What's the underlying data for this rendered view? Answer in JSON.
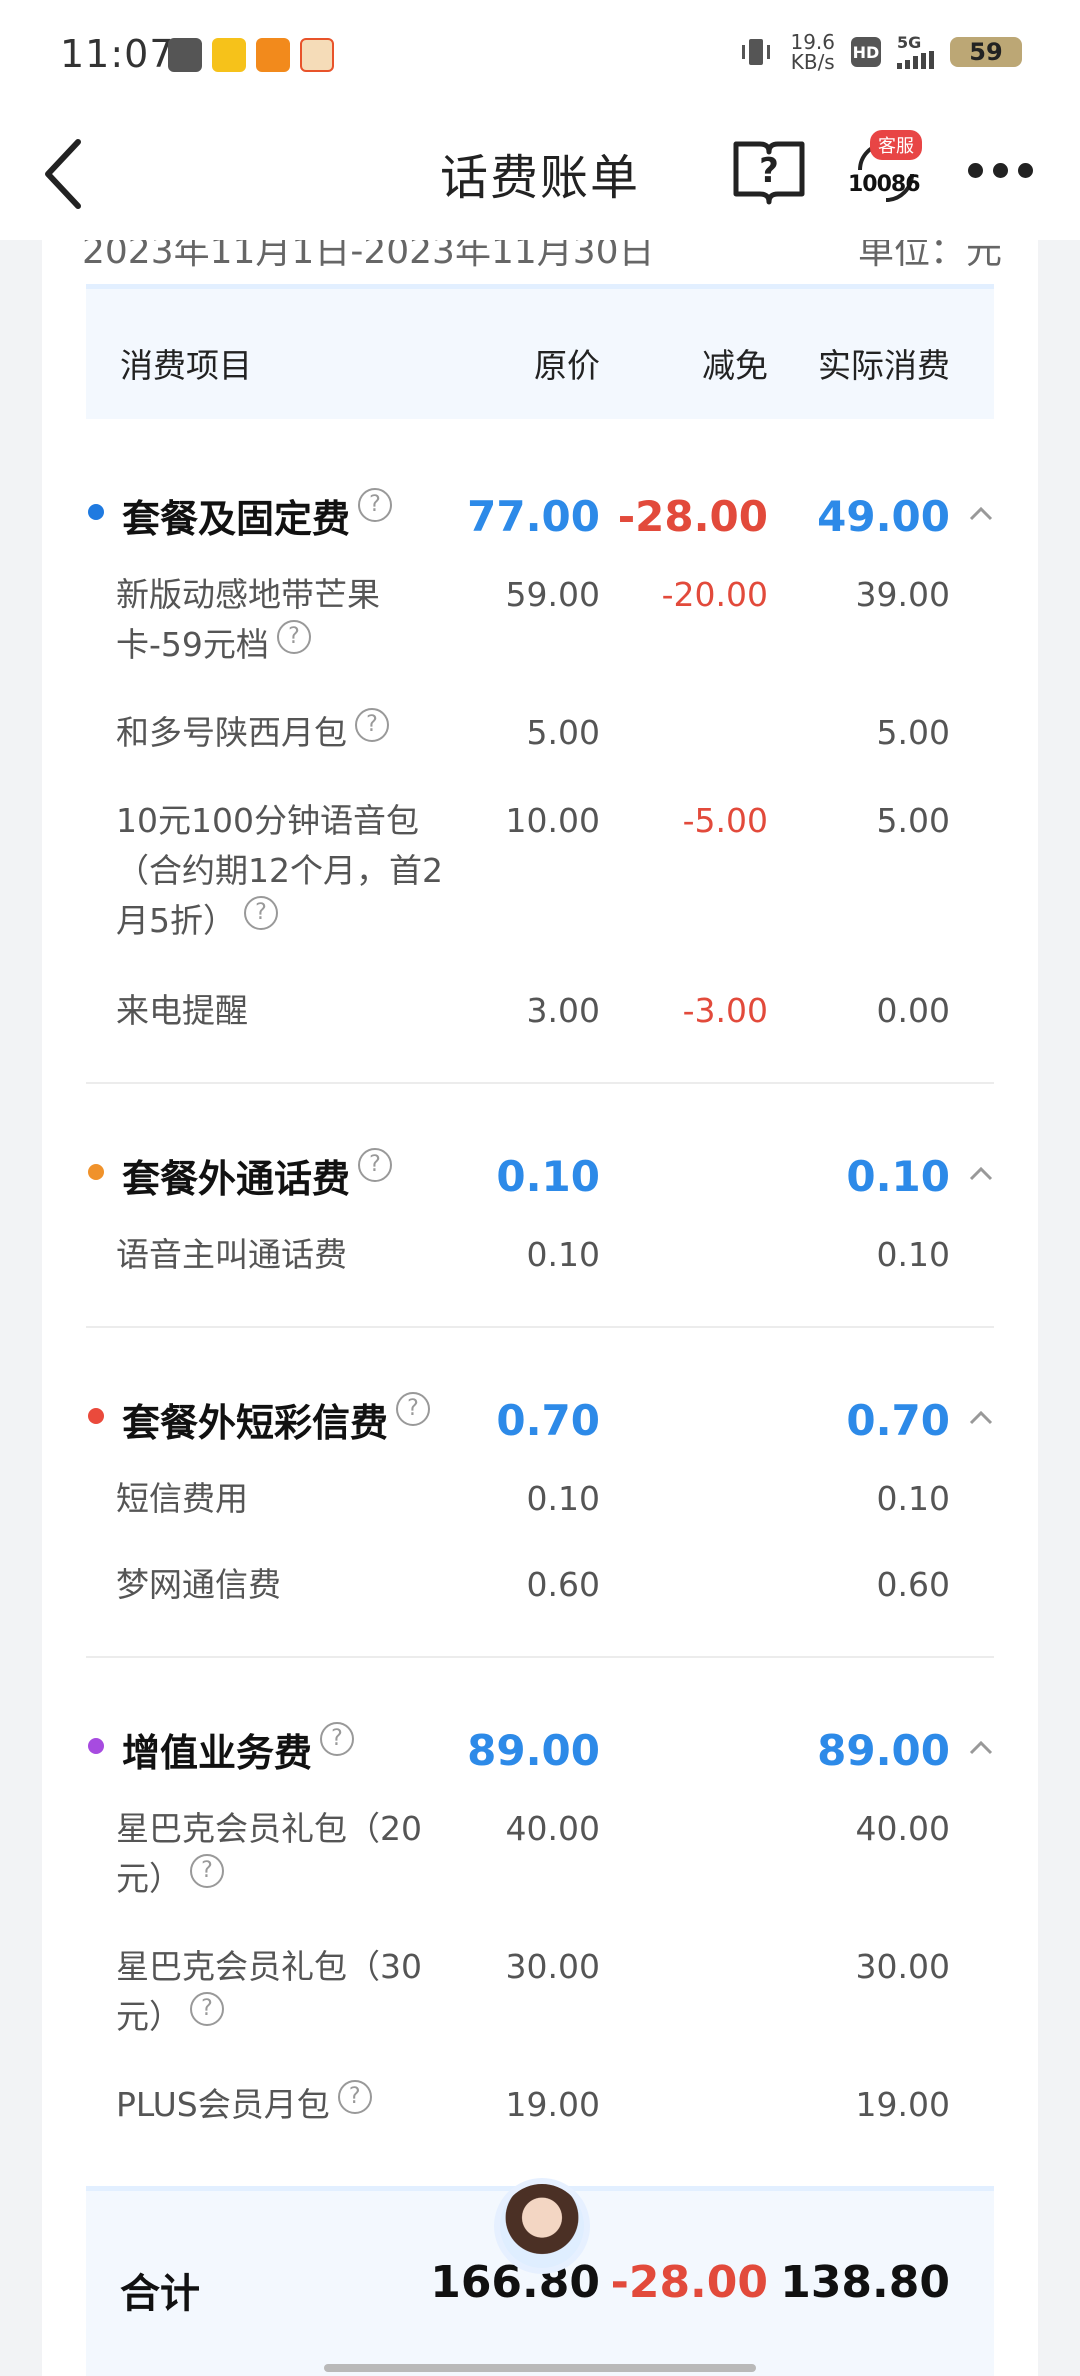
{
  "status_bar": {
    "time": "11:07",
    "net_speed_value": "19.6",
    "net_speed_unit": "KB/s",
    "hd": "HD",
    "network": "5G",
    "battery": "59"
  },
  "header": {
    "title": "话费账单",
    "service_badge": "客服",
    "service_number": "10086"
  },
  "period": {
    "range": "2023年11月1日-2023年11月30日",
    "unit": "单位：元"
  },
  "table_header": {
    "item": "消费项目",
    "original": "原价",
    "discount": "减免",
    "actual": "实际消费"
  },
  "sections": [
    {
      "title": "套餐及固定费",
      "original": "77.00",
      "discount": "-28.00",
      "actual": "49.00",
      "items": [
        {
          "name": "新版动感地带芒果卡-59元档",
          "original": "59.00",
          "discount": "-20.00",
          "actual": "39.00"
        },
        {
          "name": "和多号陕西月包",
          "original": "5.00",
          "discount": "",
          "actual": "5.00"
        },
        {
          "name": "10元100分钟语音包（合约期12个月，首2月5折）",
          "original": "10.00",
          "discount": "-5.00",
          "actual": "5.00"
        },
        {
          "name": "来电提醒",
          "original": "3.00",
          "discount": "-3.00",
          "actual": "0.00"
        }
      ]
    },
    {
      "title": "套餐外通话费",
      "original": "0.10",
      "discount": "",
      "actual": "0.10",
      "items": [
        {
          "name": "语音主叫通话费",
          "original": "0.10",
          "discount": "",
          "actual": "0.10"
        }
      ]
    },
    {
      "title": "套餐外短彩信费",
      "original": "0.70",
      "discount": "",
      "actual": "0.70",
      "items": [
        {
          "name": "短信费用",
          "original": "0.10",
          "discount": "",
          "actual": "0.10"
        },
        {
          "name": "梦网通信费",
          "original": "0.60",
          "discount": "",
          "actual": "0.60"
        }
      ]
    },
    {
      "title": "增值业务费",
      "original": "89.00",
      "discount": "",
      "actual": "89.00",
      "items": [
        {
          "name": "星巴克会员礼包（20元）",
          "original": "40.00",
          "discount": "",
          "actual": "40.00"
        },
        {
          "name": "星巴克会员礼包（30元）",
          "original": "30.00",
          "discount": "",
          "actual": "30.00"
        },
        {
          "name": "PLUS会员月包",
          "original": "19.00",
          "discount": "",
          "actual": "19.00"
        }
      ]
    }
  ],
  "total": {
    "label": "合计",
    "original": "166.80",
    "discount": "-28.00",
    "actual": "138.80"
  },
  "colors": {
    "dot_1": "#1f7ae0",
    "dot_2": "#f0922b",
    "dot_3": "#ea4a3c",
    "dot_4": "#a74be0",
    "blue": "#2d8ae8",
    "red": "#e24a3b"
  },
  "icons": {
    "back": "chevron-left-icon",
    "help": "question-book-icon",
    "more": "more-dots-icon",
    "expand": "chevron-up-icon",
    "info": "question-circle-icon"
  }
}
